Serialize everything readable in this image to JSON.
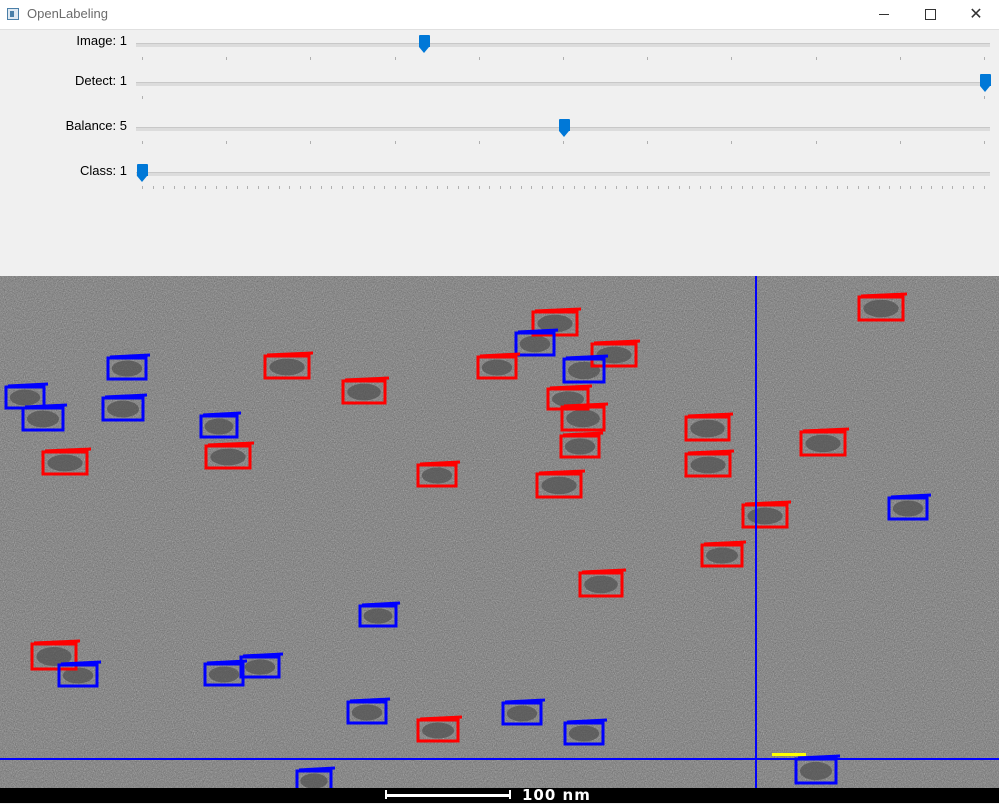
{
  "window": {
    "title": "OpenLabeling",
    "icon": "app-window-icon"
  },
  "sliders": [
    {
      "label": "Image: 1",
      "value": 1,
      "fill_fraction": 0.335,
      "ticks": 10
    },
    {
      "label": "Detect: 1",
      "value": 1,
      "fill_fraction": 1.0,
      "ticks": 1
    },
    {
      "label": "Balance: 5",
      "value": 5,
      "fill_fraction": 0.5,
      "ticks": 10
    },
    {
      "label": "Class: 1",
      "value": 1,
      "fill_fraction": 0.0,
      "ticks": 80
    }
  ],
  "scale_bar": {
    "label": "100 nm"
  },
  "colors": {
    "class_red": "#ff0000",
    "class_blue": "#0000ff",
    "crosshair": "#0000ff",
    "slider_handle": "#0078d7",
    "cursor_marker": "#ffff00"
  }
}
